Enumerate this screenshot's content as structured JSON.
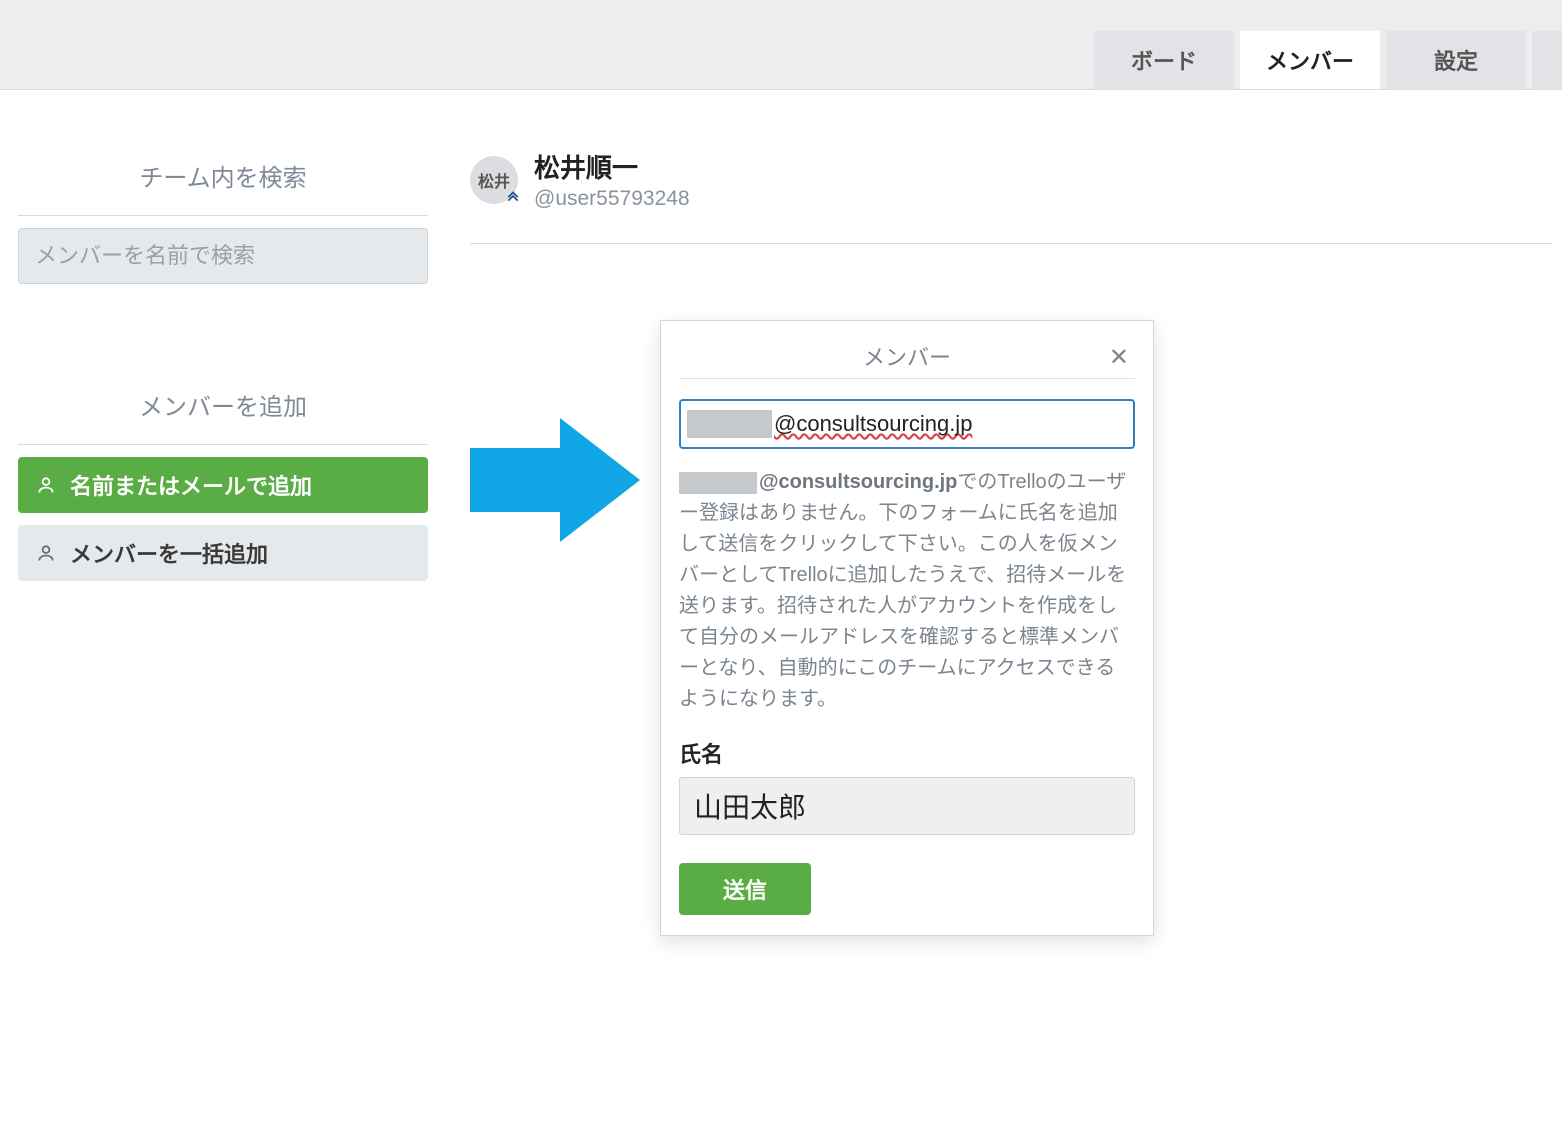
{
  "tabs": {
    "boards": "ボード",
    "members": "メンバー",
    "settings": "設定"
  },
  "sidebar": {
    "search_title": "チーム内を検索",
    "search_placeholder": "メンバーを名前で検索",
    "add_title": "メンバーを追加",
    "add_by_name_label": "名前またはメールで追加",
    "bulk_add_label": "メンバーを一括追加"
  },
  "member": {
    "avatar_initials": "松井",
    "name": "松井順一",
    "handle": "@user55793248"
  },
  "popover": {
    "title": "メンバー",
    "email_domain": "@consultsourcing.jp",
    "body_domain": "@consultsourcing.jp",
    "body_rest": "でのTrelloのユーザー登録はありません。下のフォームに氏名を追加して送信をクリックして下さい。この人を仮メンバーとしてTrelloに追加したうえで、招待メールを送ります。招待された人がアカウントを作成をして自分のメールアドレスを確認すると標準メンバーとなり、自動的にこのチームにアクセスできるようになります。",
    "name_label": "氏名",
    "name_value": "山田太郎",
    "submit_label": "送信"
  }
}
